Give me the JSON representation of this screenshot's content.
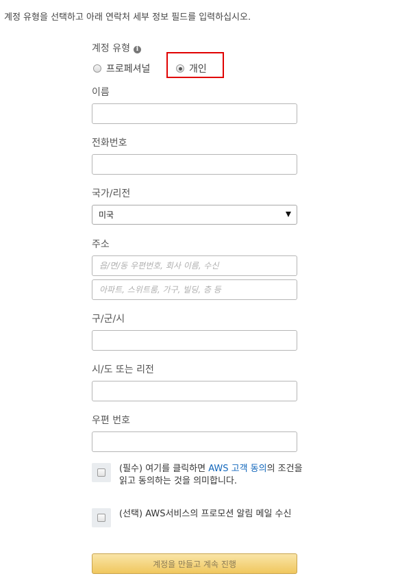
{
  "intro_text": "계정 유형을 선택하고 아래 연락처 세부 정보 필드를 입력하십시오.",
  "account_type": {
    "label": "계정 유형",
    "info_icon": "info-icon",
    "info_glyph": "i",
    "options": [
      {
        "label": "프로페셔널",
        "selected": false
      },
      {
        "label": "개인",
        "selected": true
      }
    ],
    "highlight_color": "#e00000"
  },
  "fields": {
    "name": {
      "label": "이름",
      "value": "",
      "placeholder": ""
    },
    "phone": {
      "label": "전화번호",
      "value": "",
      "placeholder": ""
    },
    "country": {
      "label": "국가/리전",
      "selected": "미국"
    },
    "address": {
      "label": "주소",
      "line1_placeholder": "읍/면/동 우편번호, 회사 이름, 수신",
      "line2_placeholder": "아파트, 스위트룸, 가구, 빌딩, 층 등"
    },
    "district": {
      "label": "구/군/시",
      "value": ""
    },
    "state": {
      "label": "시/도 또는 리전",
      "value": ""
    },
    "postal": {
      "label": "우편 번호",
      "value": ""
    }
  },
  "agreements": {
    "required": {
      "prefix": "(필수) 여기를 클릭하면 ",
      "link": "AWS 고객 동의",
      "suffix": "의 조건을 읽고 동의하는 것을 의미합니다.",
      "checked": false
    },
    "optional": {
      "text": "(선택) AWS서비스의 프로모션 알림 메일 수신",
      "checked": false
    }
  },
  "submit_label": "계정을 만들고 계속 진행",
  "colors": {
    "link": "#1166bb",
    "button_top": "#f9e5a8",
    "button_bottom": "#f0c75e"
  }
}
